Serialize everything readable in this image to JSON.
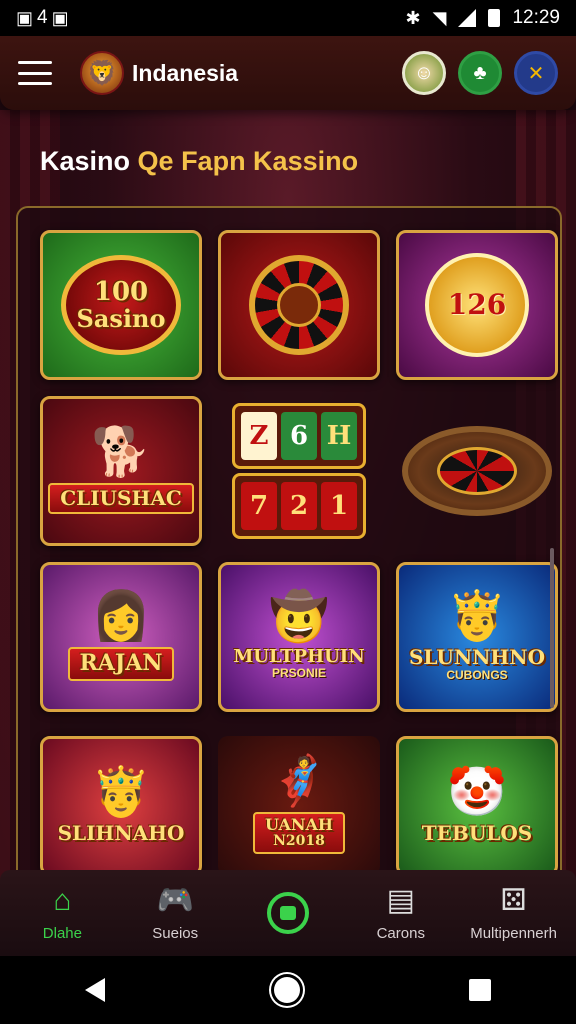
{
  "status_bar": {
    "left_text": "4",
    "time": "12:29"
  },
  "header": {
    "brand": "Indanesia",
    "logo_icon": "lion-crest-icon",
    "avatars": [
      "character-avatar-icon",
      "clover-icon",
      "crossed-swords-icon"
    ]
  },
  "section": {
    "title_white": "Kasino",
    "title_gold": "Qe Fapn Kassino"
  },
  "games": [
    {
      "title": "100",
      "subtitle": "Sasino",
      "icon": "casino-badge-icon"
    },
    {
      "title": "",
      "subtitle": "",
      "icon": "roulette-wheel-icon"
    },
    {
      "title": "126",
      "subtitle": "",
      "icon": "gold-coin-icon"
    },
    {
      "title": "CLIUSHAC",
      "subtitle": "",
      "icon": "dog-icon"
    },
    {
      "title": "",
      "subtitle": "",
      "icon": "slot-machine-icon",
      "reels": [
        "Z",
        "6",
        "H",
        "7",
        "2",
        "1"
      ]
    },
    {
      "title": "",
      "subtitle": "",
      "icon": "roulette-table-icon"
    },
    {
      "title": "RAJAN",
      "subtitle": "",
      "icon": "woman-character-icon"
    },
    {
      "title": "MULTPHUIN",
      "subtitle": "PRSONIE",
      "icon": "cowboy-character-icon"
    },
    {
      "title": "SLUNNHNO",
      "subtitle": "CUBONGS",
      "icon": "king-character-icon"
    },
    {
      "title": "SLIHNAHO",
      "subtitle": "",
      "icon": "crowned-man-icon"
    },
    {
      "title": "UANAH",
      "subtitle": "N2018",
      "icon": "wrestler-character-icon"
    },
    {
      "title": "TEBULOS",
      "subtitle": "",
      "icon": "jester-character-icon"
    }
  ],
  "bottom_nav": [
    {
      "label": "Dlahe",
      "icon": "home-icon",
      "active": true
    },
    {
      "label": "Sueios",
      "icon": "gamepad-icon",
      "active": false
    },
    {
      "label": "",
      "icon": "center-action-icon",
      "active": false
    },
    {
      "label": "Carons",
      "icon": "cards-icon",
      "active": false
    },
    {
      "label": "Multipennerh",
      "icon": "dice-icon",
      "active": false
    }
  ],
  "colors": {
    "accent_green": "#3bd24b",
    "gold": "#f4c24a",
    "header_bg": "#3d1410"
  }
}
